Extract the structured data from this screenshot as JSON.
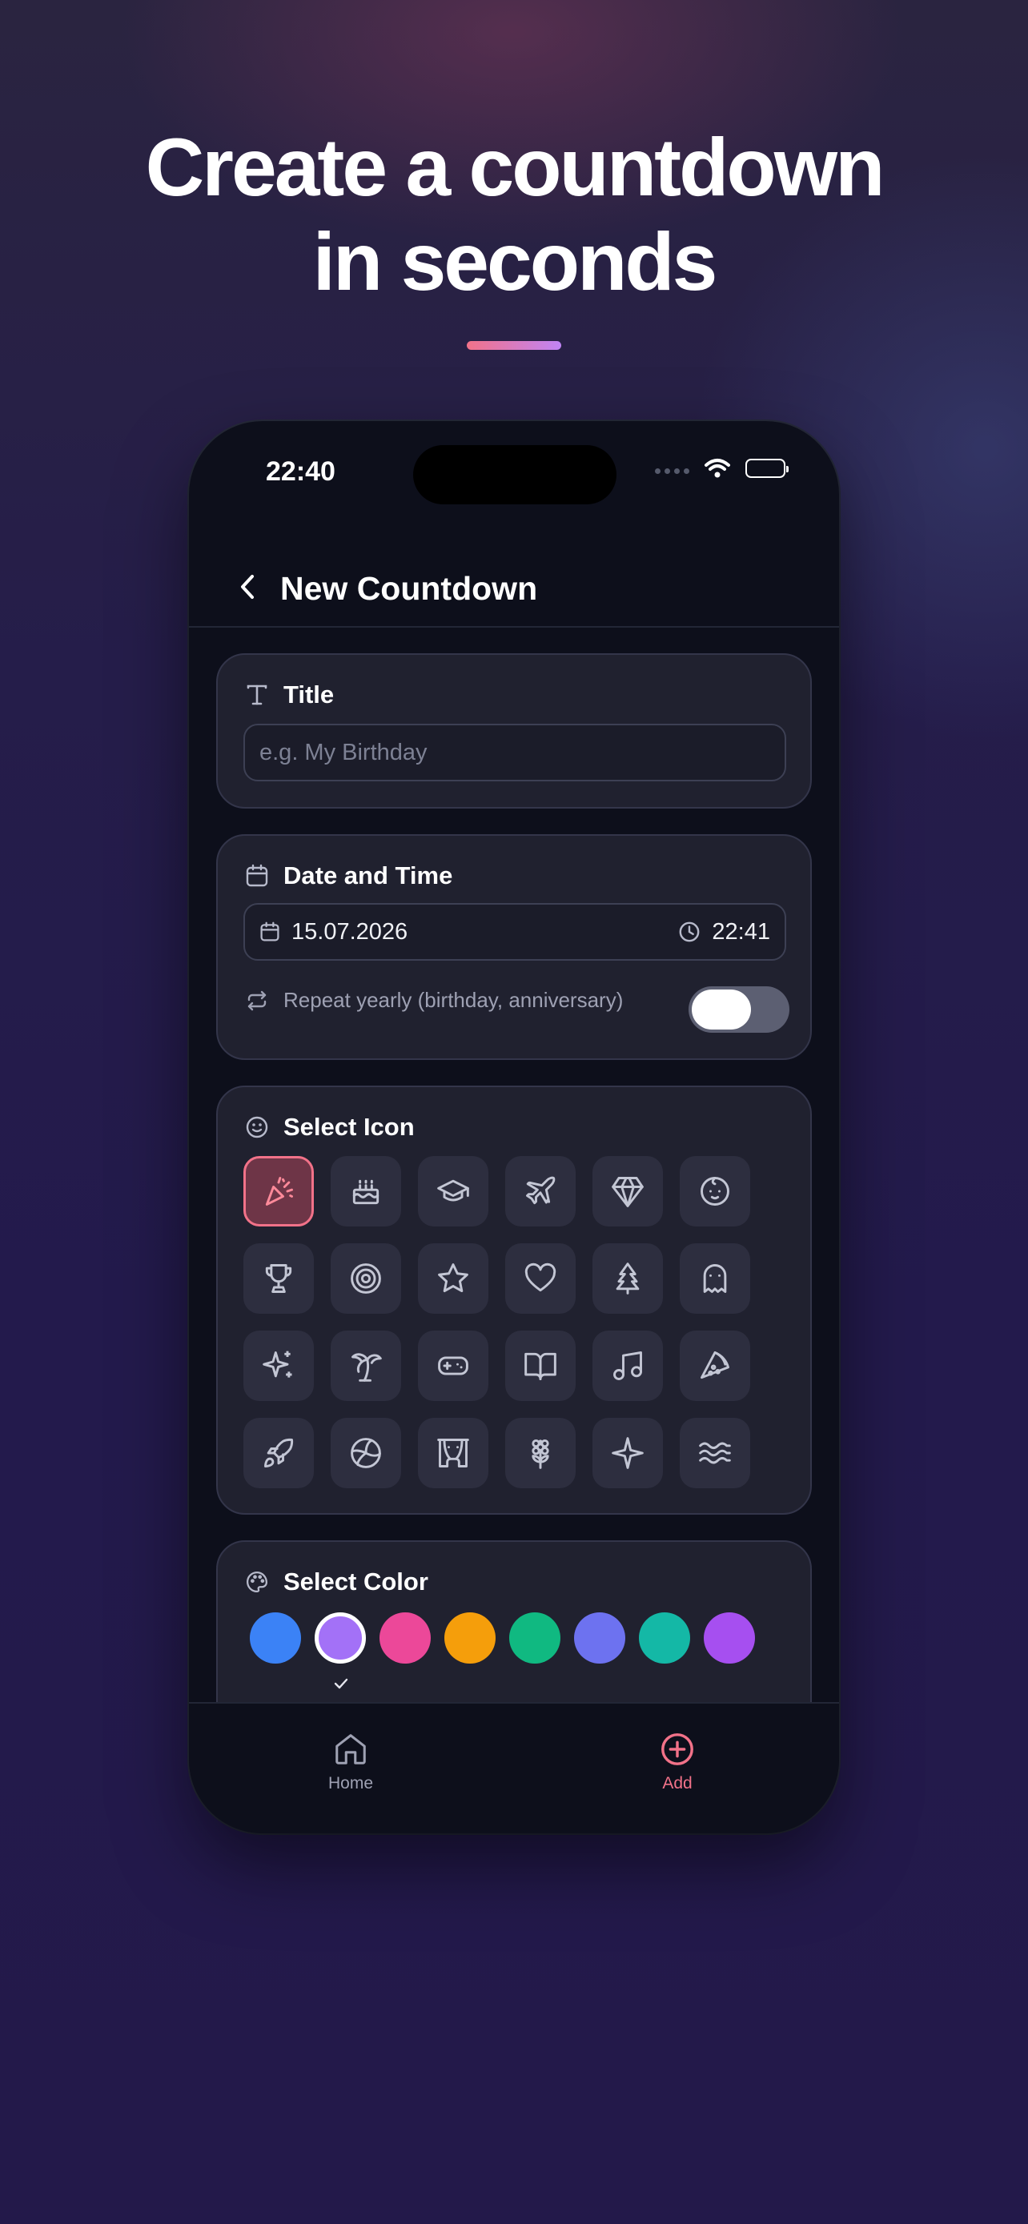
{
  "headline": {
    "line1": "Create a countdown",
    "line2": "in seconds"
  },
  "colors": {
    "accent": "#f27289",
    "accent_gradient_end": "#c084f5",
    "card_bg": "#20212f"
  },
  "status_bar": {
    "time": "22:40"
  },
  "nav": {
    "title": "New Countdown",
    "back_icon": "chevron-left-icon"
  },
  "title_card": {
    "label": "Title",
    "icon": "text-icon",
    "placeholder": "e.g. My Birthday",
    "value": ""
  },
  "date_card": {
    "label": "Date and Time",
    "icon": "calendar-icon",
    "date": "15.07.2026",
    "time": "22:41",
    "repeat_label": "Repeat yearly (birthday, anniversary)",
    "repeat_on": false
  },
  "icon_card": {
    "label": "Select Icon",
    "icon": "smile-icon",
    "selected": "party-popper-icon",
    "icons": [
      "party-popper-icon",
      "cake-icon",
      "graduation-cap-icon",
      "plane-icon",
      "gem-icon",
      "baby-icon",
      "trophy-icon",
      "target-icon",
      "star-icon",
      "heart-icon",
      "tree-icon",
      "ghost-icon",
      "sparkles-icon",
      "palm-tree-icon",
      "gamepad-icon",
      "book-icon",
      "music-icon",
      "pizza-icon",
      "rocket-icon",
      "volleyball-icon",
      "theater-icon",
      "flower-icon",
      "sparkle-icon",
      "waves-icon"
    ]
  },
  "color_card": {
    "label": "Select Color",
    "icon": "palette-icon",
    "selected_index": 1,
    "swatches": [
      "#3b82f6",
      "#a371f7",
      "#ec4899",
      "#f59e0b",
      "#10b981",
      "#6d72f0",
      "#14b8a6",
      "#a64ff0"
    ]
  },
  "tabbar": {
    "home_label": "Home",
    "add_label": "Add",
    "active": "add"
  }
}
